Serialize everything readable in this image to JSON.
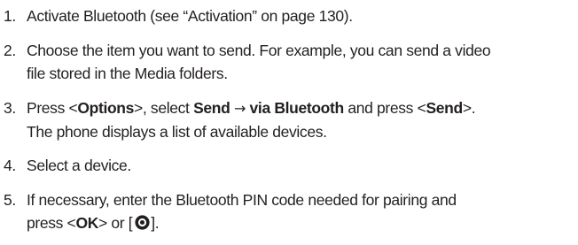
{
  "steps": [
    {
      "number": "1.",
      "text": "Activate Bluetooth (see “Activation” on page 130)."
    },
    {
      "number": "2.",
      "line1": "Choose the item you want to send. For example, you can send a video",
      "line2": "file stored in the Media folders."
    },
    {
      "number": "3.",
      "press": "Press <",
      "options": "Options",
      "select": ">, select ",
      "send": "Send",
      "arrow": "→",
      "via": "via Bluetooth",
      "and_press": " and press <",
      "send_key": "Send",
      "end": ">.",
      "line2": "The phone displays a list of available devices."
    },
    {
      "number": "4.",
      "text": "Select a device."
    },
    {
      "number": "5.",
      "line1": "If necessary, enter the Bluetooth PIN code needed for pairing and",
      "press": "press <",
      "ok": "OK",
      "or": "> or [",
      "close": "].",
      "icon": "ok-key-icon"
    }
  ]
}
